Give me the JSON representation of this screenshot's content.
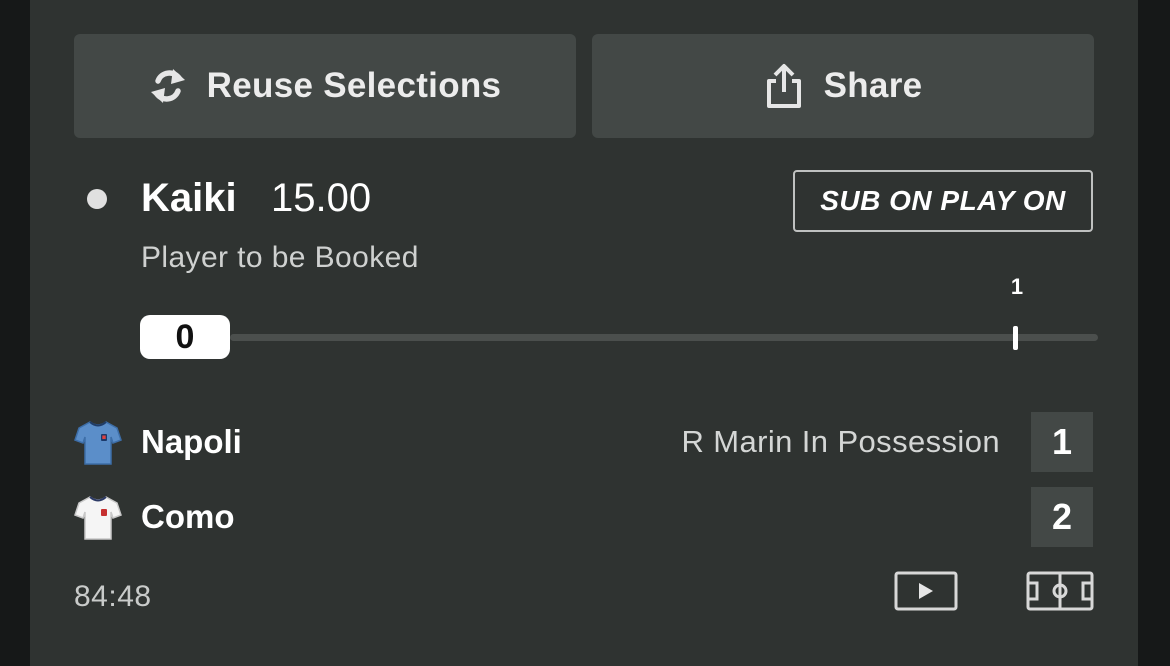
{
  "actions": {
    "reuse_label": "Reuse Selections",
    "reuse_icon": "refresh-icon",
    "share_label": "Share",
    "share_icon": "share-icon"
  },
  "selection": {
    "player": "Kaiki",
    "odds": "15.00",
    "market": "Player to be Booked",
    "badge": "SUB ON PLAY ON"
  },
  "progress": {
    "current": "0",
    "target": "1",
    "current_value": 0,
    "target_value": 1
  },
  "match": {
    "home_team": "Napoli",
    "away_team": "Como",
    "status_text": "R Marin In Possession",
    "home_score": "1",
    "away_score": "2",
    "clock": "84:48",
    "home_kit_color": "#5b8ec9",
    "away_kit_color": "#f5f5f5"
  },
  "icons": {
    "video": "play-video-icon",
    "pitch": "pitch-view-icon"
  },
  "colors": {
    "card_bg": "#2f3331",
    "button_bg": "#434846",
    "page_bg": "#161818"
  }
}
